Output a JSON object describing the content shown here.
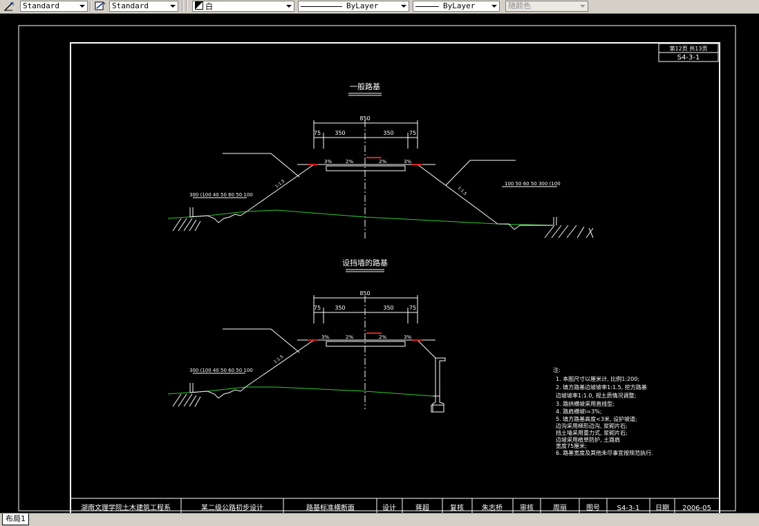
{
  "toolbar": {
    "text_style": "Standard",
    "dim_style": "Standard",
    "color_name": "白",
    "linetype": "ByLayer",
    "lineweight": "ByLayer",
    "plot_style": "随颜色"
  },
  "sheet": {
    "page_info": "第12页 共13页",
    "drawing_no_top": "S4-3-1",
    "title_block": {
      "school": "湖南文理学院土木建筑工程系",
      "project": "某二级公路初步设计",
      "drawing_title": "路基标准横断面",
      "design_label": "设计",
      "designer": "蒋超",
      "check_label": "复核",
      "checker": "朱志桥",
      "review_label": "审核",
      "reviewer": "周丽",
      "drawing_no_label": "图号",
      "drawing_no": "S4-3-1",
      "date_label": "日期",
      "date": "2006-05"
    },
    "section1": {
      "title": "一般路基",
      "total_width": "850",
      "dims": [
        "75",
        "350",
        "350",
        "75"
      ],
      "slopes": [
        "3%",
        "2%",
        "2%",
        "3%"
      ],
      "slope_ratio": "1:1.5",
      "left_ditch_dims": "300 (100 40 50 60 50 100",
      "right_ditch_dims": "100 50 60 50 300 (100"
    },
    "section2": {
      "title": "设挡墙的路基",
      "total_width": "850",
      "dims": [
        "75",
        "350",
        "350",
        "75"
      ],
      "slopes": [
        "3%",
        "2%",
        "2%",
        "3%"
      ],
      "slope_ratio": "1:1.5",
      "left_ditch_dims": "300 (100 40 50 60 50 100"
    },
    "notes": {
      "title": "注:",
      "lines": [
        "1. 本图尺寸以厘米计, 比例1:200;",
        "2. 填方路基边坡坡率1:1.5, 挖方路基",
        "   边坡坡率1:1.0, 视土质情况调整;",
        "3. 路拱横坡采用直线型;",
        "4. 路肩横坡i=3%;",
        "5. 填方路基高度<3米, 设护坡道;",
        "   边沟采用梯形边沟, 浆砌片石;",
        "   挡土墙采用重力式, 浆砌片石;",
        "   边坡采用植草防护, 土路肩",
        "   宽度75厘米;",
        "6. 路基宽度及其他未尽事宜按规范执行."
      ]
    }
  },
  "layout_tab": "布局1",
  "colors": {
    "background": "#000000",
    "lines": "#ffffff",
    "ground_line": "#2ecc2e",
    "accent_red": "#e02020"
  }
}
